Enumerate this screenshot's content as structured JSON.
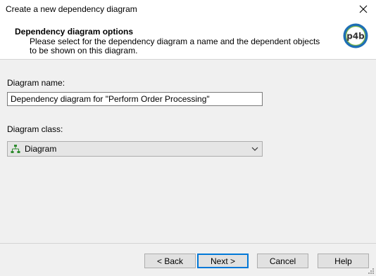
{
  "window": {
    "title": "Create a new dependency diagram",
    "close_icon": "close-icon"
  },
  "header": {
    "title": "Dependency diagram options",
    "subtitle": "Please select for the dependency diagram a name and the dependent objects to be shown on this diagram.",
    "logo_text": "p4b",
    "logo_icon": "p4b-logo-icon"
  },
  "form": {
    "name_label": "Diagram name:",
    "name_value": "Dependency diagram for \"Perform Order Processing\"",
    "class_label": "Diagram class:",
    "class_value": "Diagram",
    "class_icon": "diagram-hierarchy-icon"
  },
  "buttons": {
    "back": "< Back",
    "next": "Next >",
    "cancel": "Cancel",
    "help": "Help"
  },
  "colors": {
    "accent": "#0078d7",
    "logo_ring": "#1f6fb5",
    "logo_text": "#333333",
    "diagram_icon": "#2e8b2e"
  }
}
